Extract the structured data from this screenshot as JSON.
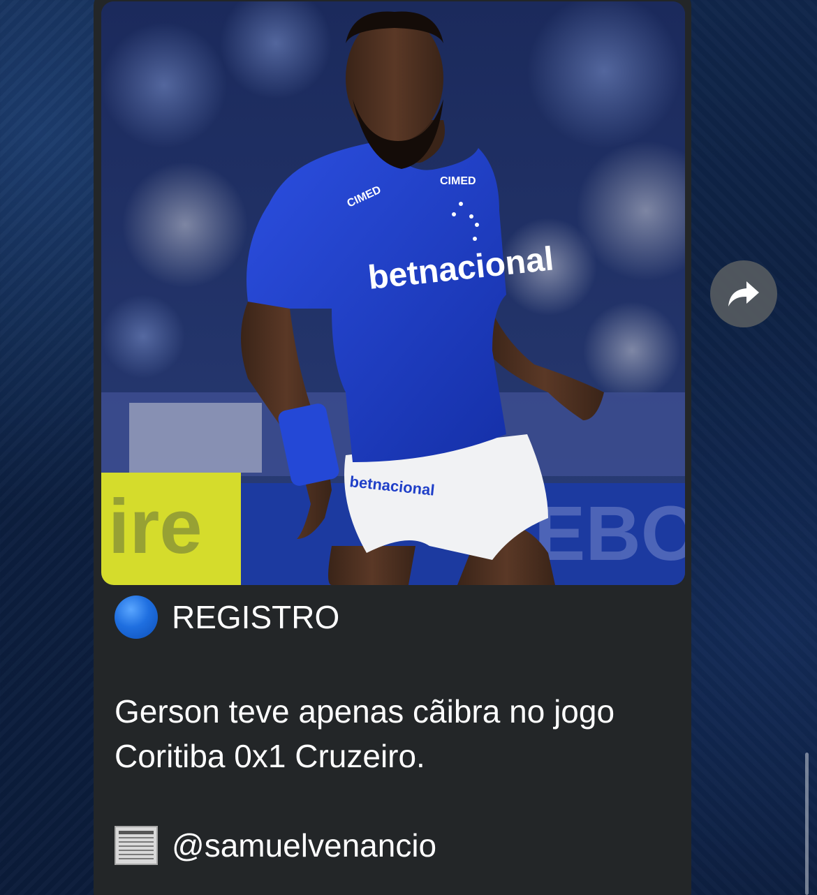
{
  "message": {
    "title": "REGISTRO",
    "title_icon": "blue-circle-icon",
    "body": "Gerson teve apenas cãibra no jogo\nCoritiba 0x1 Cruzeiro.",
    "source_icon": "newspaper-icon",
    "source_handle": "@samuelvenancio"
  },
  "photo": {
    "jersey_sponsor": "betnacional",
    "jersey_sleeve_sponsor": "CIMED",
    "shorts_sponsor": "betnacional"
  },
  "forward_button": {
    "icon": "forward-arrow-icon"
  },
  "colors": {
    "bubble_bg": "#232628",
    "wallpaper": "#0c1f3f",
    "jersey_blue": "#1f3fc8"
  }
}
